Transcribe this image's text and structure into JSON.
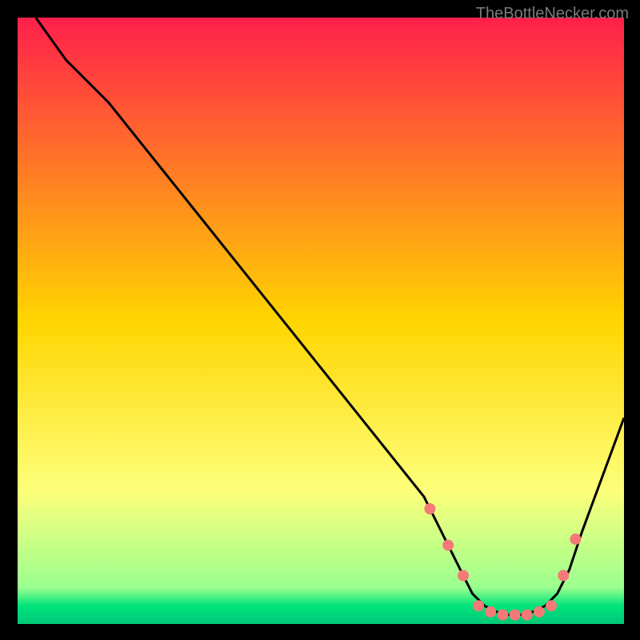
{
  "watermark": "TheBottleNecker.com",
  "chart_data": {
    "type": "line",
    "title": "",
    "xlabel": "",
    "ylabel": "",
    "xlim": [
      0,
      100
    ],
    "ylim": [
      0,
      100
    ],
    "background_gradient": {
      "stops": [
        {
          "offset": 0,
          "color": "#ff1f4b"
        },
        {
          "offset": 50,
          "color": "#ffd500"
        },
        {
          "offset": 78,
          "color": "#fdff7a"
        },
        {
          "offset": 94,
          "color": "#9bff8f"
        },
        {
          "offset": 97,
          "color": "#00e37a"
        },
        {
          "offset": 100,
          "color": "#00c878"
        }
      ]
    },
    "series": [
      {
        "name": "curve",
        "color": "#000000",
        "x": [
          3,
          8,
          15,
          67,
          70,
          73,
          75,
          77,
          79,
          81,
          83,
          85,
          87,
          89,
          91,
          93,
          100
        ],
        "y": [
          100,
          93,
          86,
          21,
          15,
          9,
          5,
          3,
          2,
          1.5,
          1.5,
          2,
          3,
          5,
          9,
          15,
          34
        ]
      }
    ],
    "markers": {
      "name": "dots",
      "color": "#f47a77",
      "radius": 7,
      "x": [
        68,
        71,
        73.5,
        76,
        78,
        80,
        82,
        84,
        86,
        88,
        90,
        92
      ],
      "y": [
        19,
        13,
        8,
        3,
        2,
        1.5,
        1.5,
        1.5,
        2,
        3,
        8,
        14
      ]
    }
  }
}
